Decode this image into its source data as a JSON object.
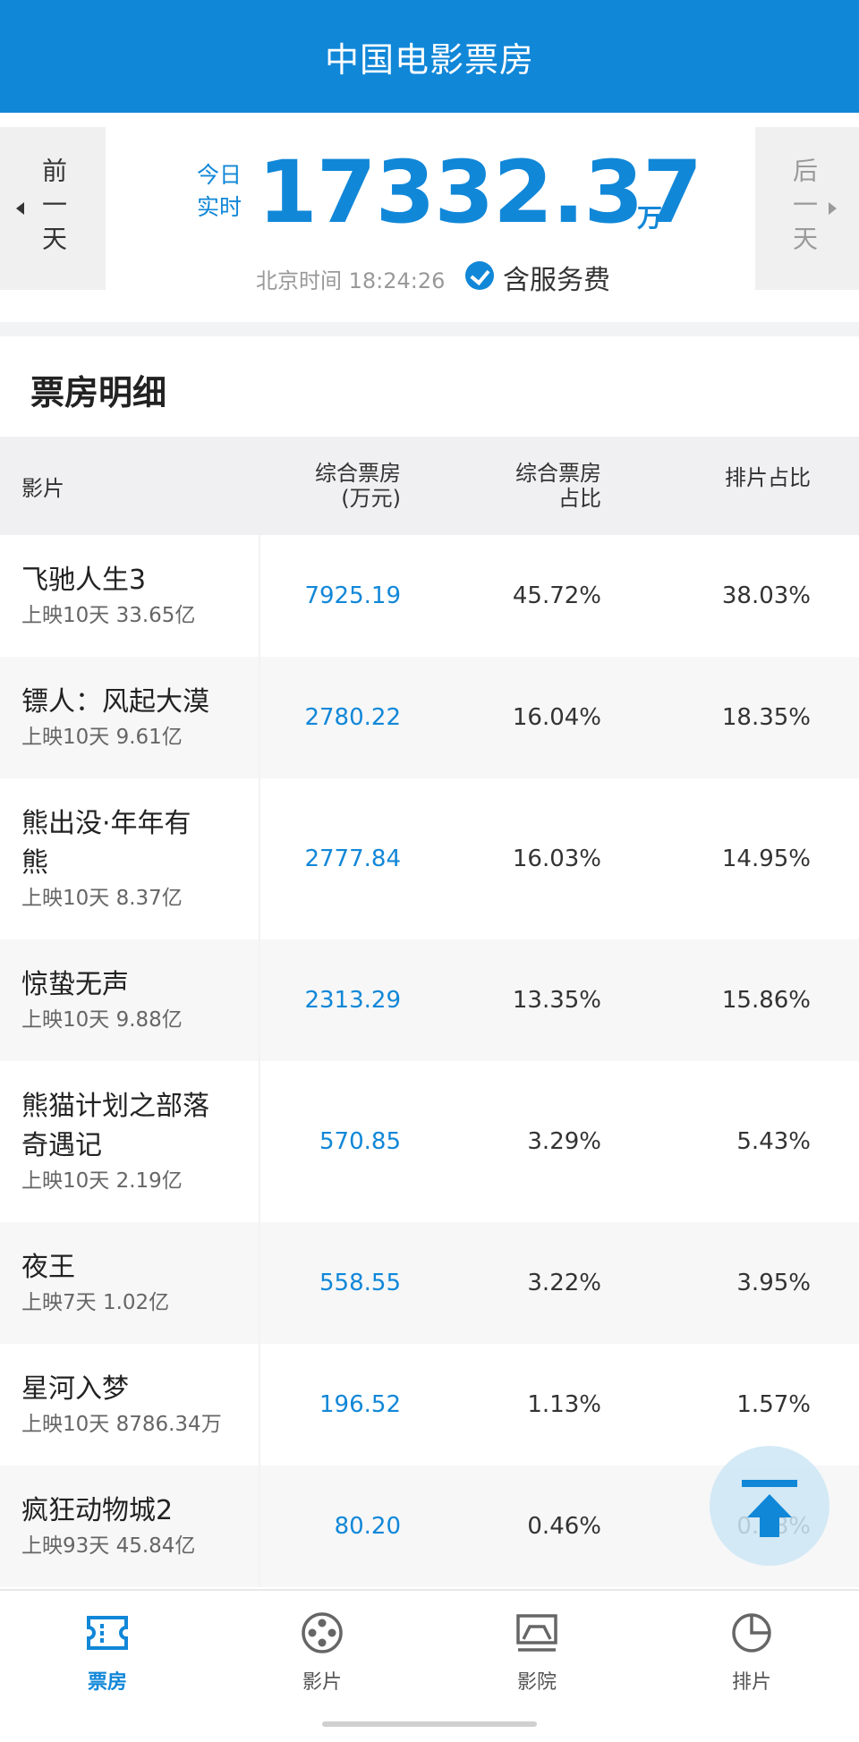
{
  "header": {
    "title": "中国电影票房"
  },
  "summary": {
    "prev_day": "前一天",
    "next_day": "后一天",
    "today_label": "今日实时",
    "total": "17332.37",
    "unit": "万",
    "time": "北京时间 18:24:26",
    "service_fee": "含服务费"
  },
  "detail": {
    "title": "票房明细",
    "columns": {
      "film": "影片",
      "box_office": "综合票房",
      "box_office_unit": "(万元)",
      "share_line1": "综合票房",
      "share_line2": "占比",
      "screening": "排片占比"
    },
    "rows": [
      {
        "name": "飞驰人生3",
        "sub": "上映10天 33.65亿",
        "box": "7925.19",
        "share": "45.72%",
        "screening": "38.03%"
      },
      {
        "name": "镖人：风起大漠",
        "sub": "上映10天 9.61亿",
        "box": "2780.22",
        "share": "16.04%",
        "screening": "18.35%"
      },
      {
        "name": "熊出没·年年有熊",
        "sub": "上映10天 8.37亿",
        "box": "2777.84",
        "share": "16.03%",
        "screening": "14.95%"
      },
      {
        "name": "惊蛰无声",
        "sub": "上映10天 9.88亿",
        "box": "2313.29",
        "share": "13.35%",
        "screening": "15.86%"
      },
      {
        "name": "熊猫计划之部落奇遇记",
        "sub": "上映10天 2.19亿",
        "box": "570.85",
        "share": "3.29%",
        "screening": "5.43%"
      },
      {
        "name": "夜王",
        "sub": "上映7天 1.02亿",
        "box": "558.55",
        "share": "3.22%",
        "screening": "3.95%"
      },
      {
        "name": "星河入梦",
        "sub": "上映10天 8786.34万",
        "box": "196.52",
        "share": "1.13%",
        "screening": "1.57%"
      },
      {
        "name": "疯狂动物城2",
        "sub": "上映93天 45.84亿",
        "box": "80.20",
        "share": "0.46%",
        "screening": "0.18%"
      }
    ]
  },
  "tabs": [
    {
      "label": "票房",
      "icon": "ticket-icon",
      "active": true
    },
    {
      "label": "影片",
      "icon": "film-reel-icon",
      "active": false
    },
    {
      "label": "影院",
      "icon": "cinema-screen-icon",
      "active": false
    },
    {
      "label": "排片",
      "icon": "pie-chart-icon",
      "active": false
    }
  ],
  "colors": {
    "accent": "#1187d8",
    "header_bg": "#1187d8",
    "row_alt": "#f7f7f8"
  }
}
